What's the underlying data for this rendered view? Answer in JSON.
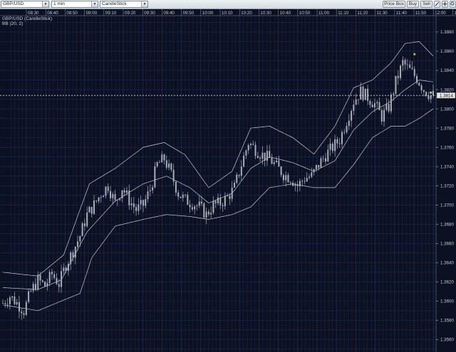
{
  "toolbar": {
    "symbol": "GBP/USD",
    "timeframe": "1 min",
    "chart_type": "CandleStick",
    "buttons": {
      "price_box": "Price Box",
      "buy": "Buy",
      "sell": "Sell"
    }
  },
  "overlay": {
    "title": "GBP/USD (CandleStick)",
    "indicator": "BB (20, 2)",
    "current_price": "1.3814"
  },
  "colors": {
    "background": "#0b1123",
    "grid": "#1d2a44",
    "candles": "#a9afb9",
    "bands": "#c4c9d2",
    "axis_text": "#c3c9d3",
    "price_tag": "#e6e6e6"
  },
  "chart_data": {
    "type": "candlestick",
    "x_tick_labels": [
      "08:30",
      "08:40",
      "08:50",
      "09:00",
      "09:10",
      "09:20",
      "09:30",
      "09:40",
      "09:50",
      "10:00",
      "10:10",
      "10:20",
      "10:30",
      "10:40",
      "10:50",
      "11:00",
      "11:10",
      "11:20",
      "11:30",
      "11:40",
      "11:50",
      "12:00",
      "12:1"
    ],
    "y_tick_labels": [
      "1.3880",
      "1.3860",
      "1.3840",
      "1.3820",
      "1.3800",
      "1.3780",
      "1.3760",
      "1.3740",
      "1.3720",
      "1.3700",
      "1.3680",
      "1.3660",
      "1.3640",
      "1.3620",
      "1.3600",
      "1.3580",
      "1.3560"
    ],
    "ylim": [
      1.3547,
      1.3897
    ],
    "grid": true,
    "current_price": 1.3814,
    "close_path": [
      [
        0,
        1.3598
      ],
      [
        3,
        1.3605
      ],
      [
        6,
        1.3598
      ],
      [
        9,
        1.359
      ],
      [
        12,
        1.361
      ],
      [
        15,
        1.3622
      ],
      [
        18,
        1.3616
      ],
      [
        21,
        1.3628
      ],
      [
        24,
        1.3618
      ],
      [
        27,
        1.3638
      ],
      [
        30,
        1.3652
      ],
      [
        33,
        1.3668
      ],
      [
        36,
        1.369
      ],
      [
        39,
        1.37
      ],
      [
        42,
        1.3712
      ],
      [
        45,
        1.372
      ],
      [
        48,
        1.3702
      ],
      [
        51,
        1.3718
      ],
      [
        54,
        1.3705
      ],
      [
        57,
        1.3695
      ],
      [
        60,
        1.37
      ],
      [
        63,
        1.3716
      ],
      [
        66,
        1.3742
      ],
      [
        69,
        1.3748
      ],
      [
        72,
        1.3732
      ],
      [
        75,
        1.3712
      ],
      [
        78,
        1.3705
      ],
      [
        81,
        1.3702
      ],
      [
        84,
        1.3698
      ],
      [
        87,
        1.369
      ],
      [
        90,
        1.37
      ],
      [
        93,
        1.3702
      ],
      [
        96,
        1.3708
      ],
      [
        99,
        1.3718
      ],
      [
        102,
        1.3742
      ],
      [
        105,
        1.3765
      ],
      [
        108,
        1.3758
      ],
      [
        111,
        1.3752
      ],
      [
        114,
        1.3748
      ],
      [
        117,
        1.374
      ],
      [
        120,
        1.3732
      ],
      [
        123,
        1.3728
      ],
      [
        126,
        1.372
      ],
      [
        129,
        1.3728
      ],
      [
        132,
        1.373
      ],
      [
        135,
        1.3742
      ],
      [
        138,
        1.3752
      ],
      [
        141,
        1.376
      ],
      [
        144,
        1.3768
      ],
      [
        147,
        1.3788
      ],
      [
        150,
        1.3808
      ],
      [
        153,
        1.3818
      ],
      [
        156,
        1.3812
      ],
      [
        159,
        1.3805
      ],
      [
        162,
        1.3792
      ],
      [
        165,
        1.3802
      ],
      [
        168,
        1.3828
      ],
      [
        171,
        1.3848
      ],
      [
        174,
        1.384
      ],
      [
        177,
        1.3832
      ],
      [
        180,
        1.382
      ],
      [
        183,
        1.3814
      ]
    ],
    "bb_upper": [
      [
        0,
        1.363
      ],
      [
        15,
        1.3626
      ],
      [
        26,
        1.3648
      ],
      [
        37,
        1.3722
      ],
      [
        48,
        1.3738
      ],
      [
        60,
        1.376
      ],
      [
        69,
        1.3765
      ],
      [
        78,
        1.3752
      ],
      [
        88,
        1.3718
      ],
      [
        98,
        1.3735
      ],
      [
        106,
        1.378
      ],
      [
        114,
        1.3782
      ],
      [
        124,
        1.377
      ],
      [
        133,
        1.3753
      ],
      [
        142,
        1.3782
      ],
      [
        150,
        1.3822
      ],
      [
        158,
        1.383
      ],
      [
        166,
        1.3848
      ],
      [
        172,
        1.3868
      ],
      [
        178,
        1.387
      ],
      [
        184,
        1.3855
      ]
    ],
    "bb_middle": [
      [
        0,
        1.3614
      ],
      [
        15,
        1.3612
      ],
      [
        25,
        1.3622
      ],
      [
        36,
        1.3672
      ],
      [
        48,
        1.3704
      ],
      [
        60,
        1.3722
      ],
      [
        70,
        1.373
      ],
      [
        80,
        1.3718
      ],
      [
        88,
        1.3702
      ],
      [
        98,
        1.3712
      ],
      [
        106,
        1.3738
      ],
      [
        114,
        1.375
      ],
      [
        124,
        1.3744
      ],
      [
        133,
        1.3735
      ],
      [
        142,
        1.3746
      ],
      [
        150,
        1.3778
      ],
      [
        158,
        1.3797
      ],
      [
        166,
        1.3808
      ],
      [
        172,
        1.382
      ],
      [
        178,
        1.383
      ],
      [
        184,
        1.3828
      ]
    ],
    "bb_lower": [
      [
        0,
        1.3596
      ],
      [
        15,
        1.359
      ],
      [
        25,
        1.36
      ],
      [
        33,
        1.3608
      ],
      [
        38,
        1.3645
      ],
      [
        48,
        1.3678
      ],
      [
        60,
        1.3685
      ],
      [
        70,
        1.369
      ],
      [
        80,
        1.3688
      ],
      [
        88,
        1.3685
      ],
      [
        98,
        1.369
      ],
      [
        106,
        1.3698
      ],
      [
        114,
        1.3718
      ],
      [
        124,
        1.3722
      ],
      [
        133,
        1.3718
      ],
      [
        142,
        1.3718
      ],
      [
        150,
        1.3742
      ],
      [
        158,
        1.377
      ],
      [
        166,
        1.3782
      ],
      [
        172,
        1.3782
      ],
      [
        178,
        1.379
      ],
      [
        184,
        1.38
      ]
    ]
  }
}
